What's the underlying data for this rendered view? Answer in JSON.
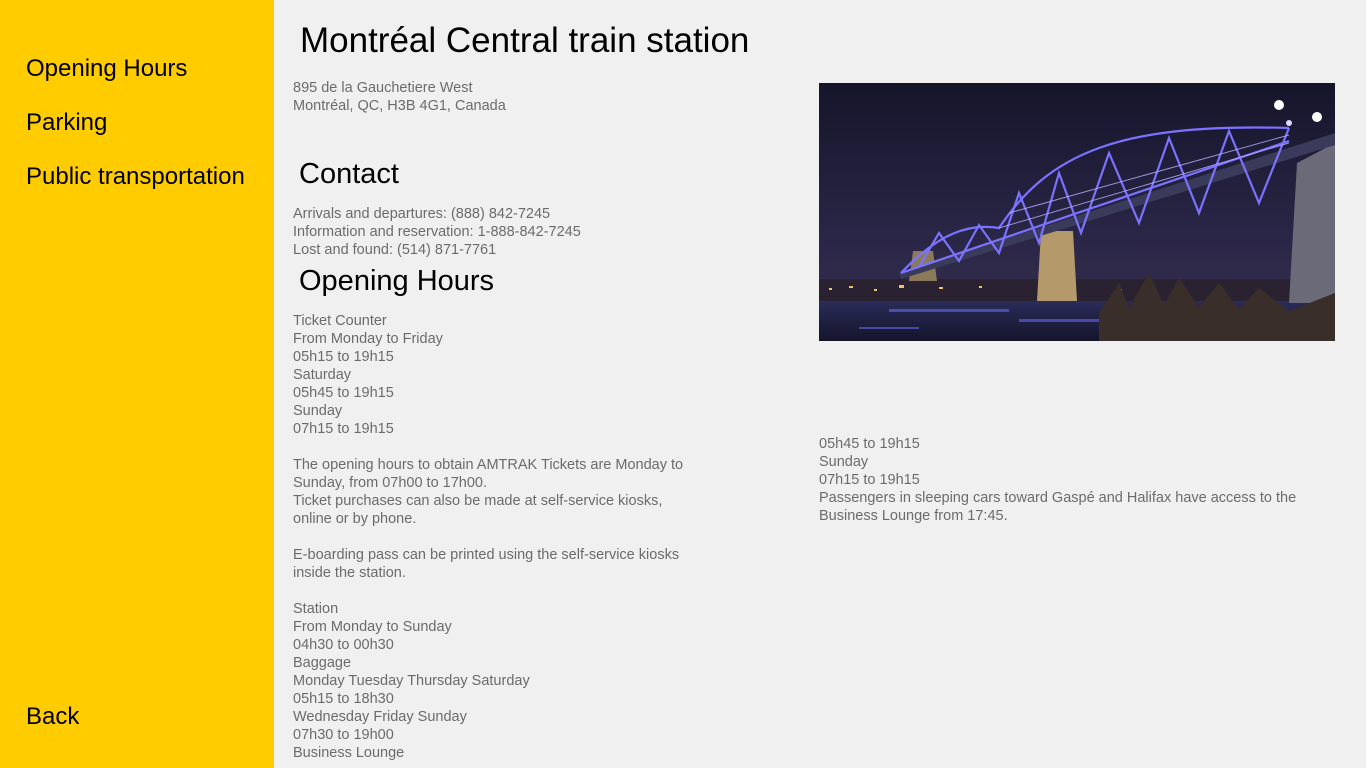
{
  "sidebar": {
    "items": [
      "Opening Hours",
      "Parking",
      "Public transportation"
    ],
    "back": "Back"
  },
  "page": {
    "title": "Montréal Central train station",
    "address": [
      "895 de la Gauchetiere West",
      "Montréal, QC, H3B 4G1, Canada"
    ]
  },
  "contact": {
    "heading": "Contact",
    "lines": [
      "Arrivals and departures: (888) 842-7245",
      "Information and reservation: 1-888-842-7245",
      "Lost and found: (514) 871-7761"
    ]
  },
  "hours": {
    "heading": "Opening Hours",
    "lines": [
      "Ticket Counter",
      "From Monday to Friday",
      "05h15 to 19h15",
      "Saturday",
      "05h45 to 19h15",
      "Sunday",
      "07h15 to 19h15",
      "",
      "The opening hours to obtain AMTRAK Tickets are Monday to",
      "Sunday, from 07h00 to 17h00.",
      "Ticket purchases can also be made at self-service kiosks,",
      "online or by phone.",
      "",
      "E-boarding pass can be printed using the self-service kiosks",
      "inside the station.",
      "",
      "Station",
      "From Monday to Sunday",
      "04h30 to 00h30",
      "Baggage",
      "Monday Tuesday Thursday Saturday",
      "05h15 to 18h30",
      "Wednesday Friday Sunday",
      "07h30 to 19h00",
      "Business Lounge"
    ],
    "continued": [
      "05h45 to 19h15",
      "Sunday",
      "07h15 to 19h15",
      "Passengers in sleeping cars toward Gaspé and Halifax have access to the",
      "Business Lounge from 17:45."
    ]
  },
  "colors": {
    "sidebar": "#ffcc00",
    "background": "#f0f0f0",
    "body_text": "#6b6b6b"
  }
}
